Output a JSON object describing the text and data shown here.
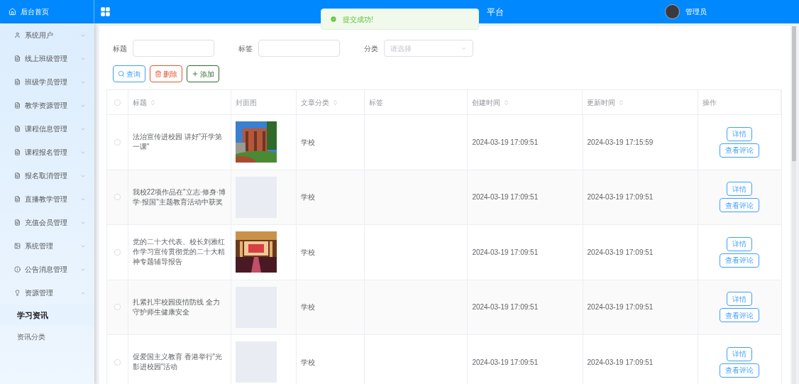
{
  "header": {
    "home": "后台首页",
    "title": "平台",
    "user": "管理员"
  },
  "toast": {
    "kind": "success",
    "text": "提交成功!"
  },
  "sidebar": {
    "items": [
      {
        "label": "系统用户",
        "kind": "user",
        "expanded": false
      },
      {
        "label": "线上班级管理",
        "kind": "doc",
        "expanded": false
      },
      {
        "label": "班级学员管理",
        "kind": "doc",
        "expanded": false
      },
      {
        "label": "教学资源管理",
        "kind": "doc",
        "expanded": false
      },
      {
        "label": "课程信息管理",
        "kind": "doc",
        "expanded": false
      },
      {
        "label": "课程报名管理",
        "kind": "doc",
        "expanded": false
      },
      {
        "label": "报名取消管理",
        "kind": "doc",
        "expanded": false
      },
      {
        "label": "直播教学管理",
        "kind": "doc",
        "expanded": false
      },
      {
        "label": "充值会员管理",
        "kind": "doc",
        "expanded": false
      },
      {
        "label": "系统管理",
        "expanded": false
      },
      {
        "label": "公告消息管理",
        "kind": "info",
        "expanded": false
      },
      {
        "label": "资源管理",
        "kind": "bulb",
        "expanded": true,
        "children": [
          {
            "label": "学习资讯",
            "selected": true
          },
          {
            "label": "资讯分类",
            "selected": false
          }
        ]
      }
    ]
  },
  "filters": [
    {
      "label": "标题",
      "kind": "input"
    },
    {
      "label": "标签",
      "kind": "input"
    },
    {
      "label": "分类",
      "kind": "select",
      "placeholder": "请选择"
    }
  ],
  "actions": [
    {
      "label": "查询",
      "kind": "search"
    },
    {
      "label": "删除",
      "kind": "delete"
    },
    {
      "label": "添加",
      "kind": "add"
    }
  ],
  "table": {
    "all_checked": false,
    "columns": [
      {
        "label": "标题",
        "sortable": true
      },
      {
        "label": "封面图",
        "sortable": false
      },
      {
        "label": "文章分类",
        "sortable": true
      },
      {
        "label": "标签",
        "sortable": false
      },
      {
        "label": "创建时间",
        "sortable": true
      },
      {
        "label": "更新时间",
        "sortable": true
      },
      {
        "label": "操作",
        "sortable": false
      }
    ],
    "rows": [
      {
        "checked": false,
        "title": "法治宣传进校园 讲好\"开学第一课\"",
        "cover": {
          "kind": "building"
        },
        "category": "学校",
        "created": "2024-03-19 17:09:51",
        "updated": "2024-03-19 17:15:59",
        "buttons": [
          "详情",
          "查看评论"
        ]
      },
      {
        "checked": false,
        "title": "我校22项作品在\"立志·修身·博学·报国\"主题教育活动中获奖",
        "cover": {
          "kind": "empty"
        },
        "category": "学校",
        "created": "2024-03-19 17:09:51",
        "updated": "2024-03-19 17:09:51",
        "buttons": [
          "详情",
          "查看评论"
        ]
      },
      {
        "checked": false,
        "title": "党的二十大代表、校长刘雅红作学习宣传贯彻党的二十大精神专题辅导报告",
        "cover": {
          "kind": "hall"
        },
        "category": "学校",
        "created": "2024-03-19 17:09:51",
        "updated": "2024-03-19 17:09:51",
        "buttons": [
          "详情",
          "查看评论"
        ]
      },
      {
        "checked": false,
        "title": "扎紧扎牢校园疫情防线 全力守护师生健康安全",
        "cover": {
          "kind": "empty"
        },
        "category": "学校",
        "created": "2024-03-19 17:09:51",
        "updated": "2024-03-19 17:09:51",
        "buttons": [
          "详情",
          "查看评论"
        ]
      },
      {
        "checked": false,
        "title": "促爱国主义教育 香港举行\"光影进校园\"活动",
        "cover": {
          "kind": "empty"
        },
        "category": "学校",
        "created": "2024-03-19 17:09:51",
        "updated": "2024-03-19 17:09:51",
        "buttons": [
          "详情",
          "查看评论"
        ]
      }
    ]
  }
}
